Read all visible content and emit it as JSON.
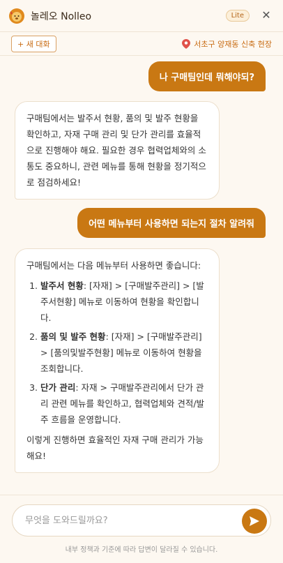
{
  "header": {
    "title": "놀레오 Nolleo",
    "badge": "Lite",
    "close_icon": "close-icon"
  },
  "subbar": {
    "new_chat_label": "+ 새 대화",
    "location": "서초구 양재동 신축 현장"
  },
  "messages": {
    "user1": "나 구매팀인데 뭐해야되?",
    "bot1": "구매팀에서는 발주서 현황, 품의 및 발주 현황을 확인하고, 자재 구매 관리 및 단가 관리를 효율적으로 진행해야 해요. 필요한 경우 협력업체와의 소통도 중요하니, 관련 메뉴를 통해 현황을 정기적으로 점검하세요!",
    "user2": "어떤 메뉴부터 사용하면 되는지 절차 알려줘",
    "bot2": {
      "intro": "구매팀에서는 다음 메뉴부터 사용하면 좋습니다:",
      "steps": [
        {
          "title": "발주서 현황",
          "text": ": [자재] > [구매발주관리] > [발주서현황] 메뉴로 이동하여 현황을 확인합니다."
        },
        {
          "title": "품의 및 발주 현황",
          "text": ": [자재] > [구매발주관리] > [품의및발주현황] 메뉴로 이동하여 현황을 조회합니다."
        },
        {
          "title": "단가 관리",
          "text": ": 자재 > 구매발주관리에서 단가 관리 관련 메뉴를 확인하고, 협력업체와 견적/발주 흐름을 운영합니다."
        }
      ],
      "outro": "이렇게 진행하면 효율적인 자재 구매 관리가 가능해요!"
    }
  },
  "input": {
    "placeholder": "무엇을 도와드릴까요?",
    "value": ""
  },
  "footer": {
    "note": "내부 정책과 기준에 따라 답변이 달라질 수 있습니다."
  },
  "colors": {
    "accent": "#c97813",
    "background": "#fdf8f1"
  }
}
